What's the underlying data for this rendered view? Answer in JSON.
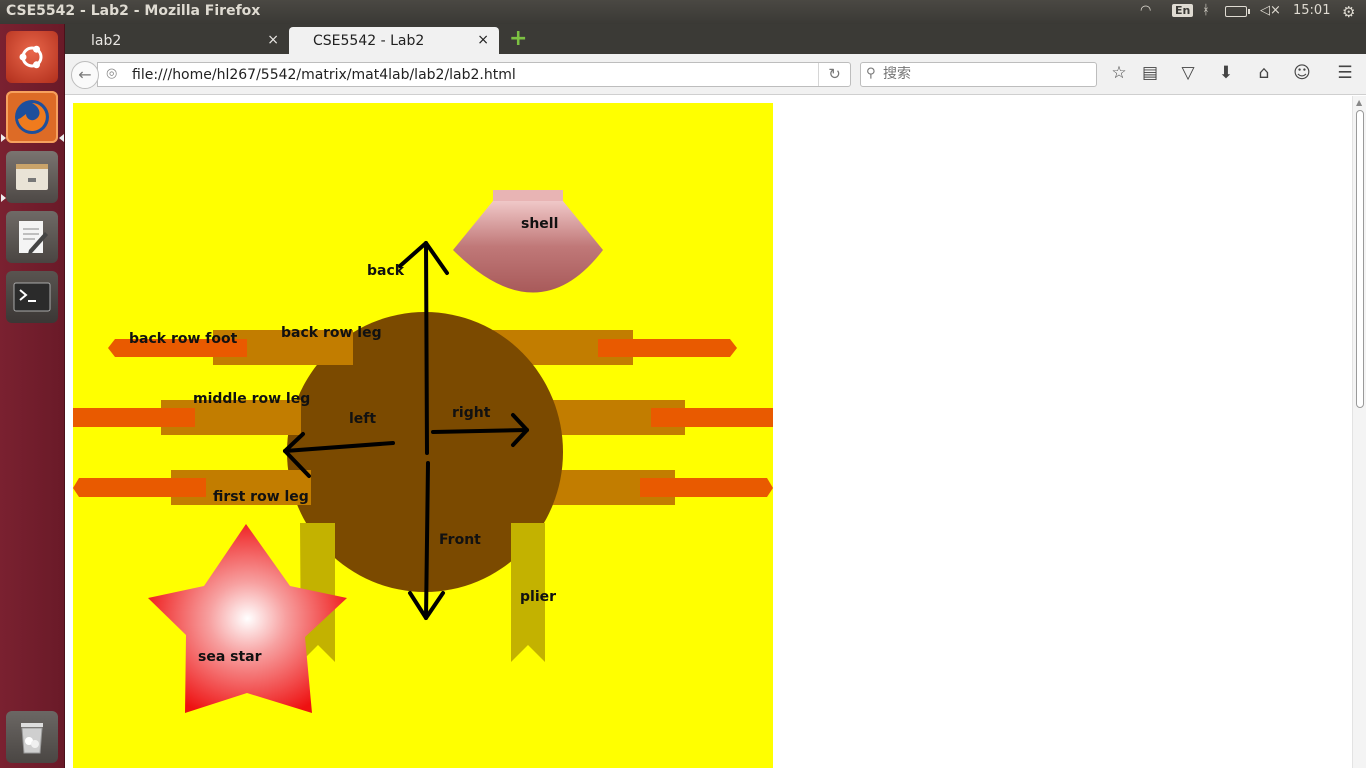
{
  "top_panel": {
    "window_title": "CSE5542 - Lab2 - Mozilla Firefox",
    "clock": "15:01",
    "language_indicator": "En",
    "icons": [
      "wifi-icon",
      "keyboard-layout-icon",
      "bluetooth-icon",
      "battery-icon",
      "volume-muted-icon",
      "settings-gear-icon"
    ]
  },
  "launcher": {
    "items": [
      "ubuntu-dash-icon",
      "firefox-icon",
      "files-icon",
      "text-editor-icon",
      "terminal-icon",
      "trash-icon"
    ]
  },
  "browser": {
    "tabs": [
      {
        "label": "lab2",
        "active": false
      },
      {
        "label": "CSE5542 - Lab2",
        "active": true
      }
    ],
    "close_glyph": "×",
    "new_tab_glyph": "+",
    "url": "file:///home/hl267/5542/matrix/mat4lab/lab2/lab2.html",
    "search_placeholder": "搜索",
    "toolbar_icons": [
      "bookmark-star-icon",
      "reading-list-icon",
      "pocket-icon",
      "download-icon",
      "home-icon",
      "chat-icon",
      "menu-icon"
    ]
  },
  "scene": {
    "background_color": "#ffff00",
    "labels": {
      "shell": "shell",
      "back": "back",
      "back_row_foot": "back row foot",
      "back_row_leg": "back row leg",
      "middle_row_leg": "middle row leg",
      "left": "left",
      "right": "right",
      "first_row_leg": "first row leg",
      "front": "Front",
      "plier": "plier",
      "sea_star": "sea star"
    },
    "colors": {
      "body": "#7b4a00",
      "leg": "#c27d00",
      "foot": "#e95a00",
      "plier": "#c3b200",
      "shell": "#b96b6b",
      "sea_star": "#ee1111"
    }
  }
}
